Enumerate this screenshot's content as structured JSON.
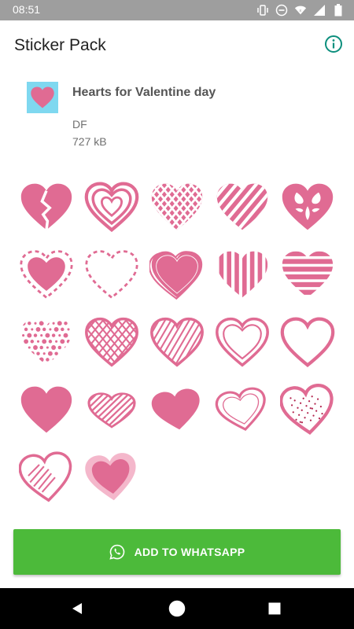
{
  "status_bar": {
    "time": "08:51",
    "icons": [
      "vibrate-icon",
      "do-not-disturb-icon",
      "wifi-icon",
      "cellular-icon",
      "battery-icon"
    ]
  },
  "app_bar": {
    "title": "Sticker Pack",
    "info_icon": "info-icon"
  },
  "pack": {
    "name": "Hearts for Valentine day",
    "publisher": "DF",
    "size": "727 kB",
    "tray_icon": "heart-icon"
  },
  "stickers": [
    {
      "style": "broken"
    },
    {
      "style": "outline-nested"
    },
    {
      "style": "lattice"
    },
    {
      "style": "diagonal-stripes"
    },
    {
      "style": "ornament"
    },
    {
      "style": "dashed-filled"
    },
    {
      "style": "dashed-outline"
    },
    {
      "style": "scribble"
    },
    {
      "style": "vertical-stripes"
    },
    {
      "style": "horizontal-stripes"
    },
    {
      "style": "dots"
    },
    {
      "style": "crosshatch"
    },
    {
      "style": "hatched"
    },
    {
      "style": "double-outline"
    },
    {
      "style": "outline"
    },
    {
      "style": "filled"
    },
    {
      "style": "sketch-stripes"
    },
    {
      "style": "filled-tilted"
    },
    {
      "style": "outline-tilted"
    },
    {
      "style": "speckled"
    },
    {
      "style": "scribble-outline"
    },
    {
      "style": "pale-bordered"
    }
  ],
  "colors": {
    "sticker_pink": "#e06b93",
    "accent_green": "#4cba3a",
    "info_teal": "#0c8f7d",
    "tray_bg": "#7fd8f0"
  },
  "actions": {
    "add_label": "ADD TO WHATSAPP",
    "add_icon": "whatsapp-icon"
  },
  "nav": {
    "back_icon": "back-icon",
    "home_icon": "home-icon",
    "recents_icon": "recents-icon"
  }
}
